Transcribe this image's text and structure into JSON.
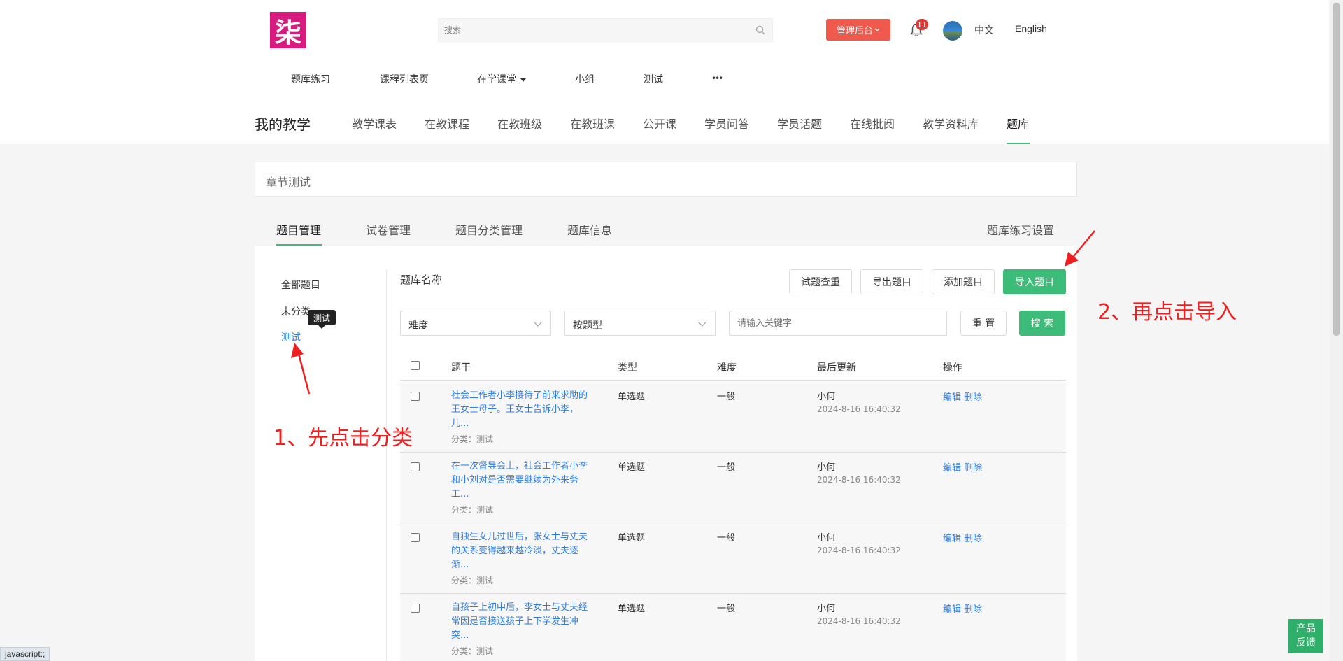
{
  "header": {
    "logo_text": "柒",
    "search_placeholder": "搜索",
    "admin_label": "管理后台",
    "notification_count": "11",
    "lang_cn": "中文",
    "lang_en": "English"
  },
  "top_nav": [
    "题库练习",
    "课程列表页",
    "在学课堂",
    "小组",
    "测试",
    "•••"
  ],
  "teach": {
    "title": "我的教学",
    "items": [
      "教学课表",
      "在教课程",
      "在教班级",
      "在教班课",
      "公开课",
      "学员问答",
      "学员话题",
      "在线批阅",
      "教学资料库",
      "题库"
    ]
  },
  "breadcrumb": "章节测试",
  "tabs": [
    "题目管理",
    "试卷管理",
    "题目分类管理",
    "题库信息"
  ],
  "practice_settings": "题库练习设置",
  "sidebar": [
    "全部题目",
    "未分类",
    "测试"
  ],
  "tooltip": "测试",
  "toolbar": {
    "bank_name": "题库名称",
    "dedupe": "试题查重",
    "export": "导出题目",
    "add": "添加题目",
    "import": "导入题目"
  },
  "filters": {
    "difficulty": "难度",
    "type": "按题型",
    "keyword_placeholder": "请输入关键字",
    "reset": "重 置",
    "search": "搜 索"
  },
  "table": {
    "headers": [
      "题干",
      "类型",
      "难度",
      "最后更新",
      "操作"
    ],
    "rows": [
      {
        "title": "社会工作者小李接待了前来求助的王女士母子。王女士告诉小李，儿...",
        "category": "分类：测试",
        "type": "单选题",
        "difficulty": "一般",
        "author": "小何",
        "time": "2024-8-16 16:40:32",
        "edit": "编辑",
        "delete": "删除"
      },
      {
        "title": "在一次督导会上，社会工作者小李和小刘对是否需要继续为外来务工...",
        "category": "分类：测试",
        "type": "单选题",
        "difficulty": "一般",
        "author": "小何",
        "time": "2024-8-16 16:40:32",
        "edit": "编辑",
        "delete": "删除"
      },
      {
        "title": "自独生女儿过世后，张女士与丈夫的关系变得越来越冷淡，丈夫逐渐...",
        "category": "分类：测试",
        "type": "单选题",
        "difficulty": "一般",
        "author": "小何",
        "time": "2024-8-16 16:40:32",
        "edit": "编辑",
        "delete": "删除"
      },
      {
        "title": "自孩子上初中后，李女士与丈夫经常因是否接送孩子上下学发生冲突...",
        "category": "分类：测试",
        "type": "单选题",
        "difficulty": "一般",
        "author": "小何",
        "time": "2024-8-16 16:40:32",
        "edit": "编辑",
        "delete": "删除"
      }
    ]
  },
  "annotations": {
    "step1": "1、先点击分类",
    "step2": "2、再点击导入"
  },
  "status_bar": "javascript:;",
  "feedback": {
    "line1": "产品",
    "line2": "反馈"
  },
  "colors": {
    "accent": "#3dbb78",
    "link": "#2f7de1",
    "admin": "#f05a4d",
    "annotation": "#f01f1f"
  }
}
